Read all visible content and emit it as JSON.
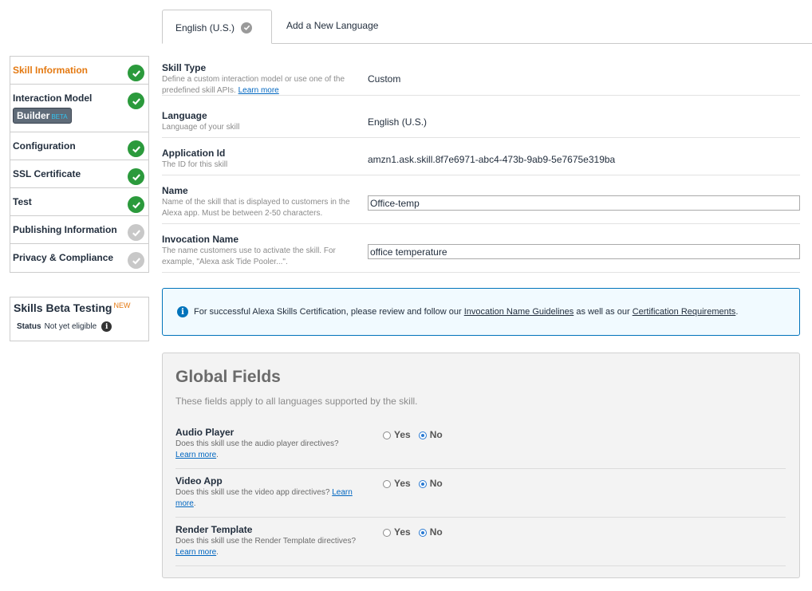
{
  "tabs": {
    "active": "English (U.S.)",
    "add": "Add a New Language"
  },
  "sidebar": {
    "items": [
      {
        "label": "Skill Information",
        "status": "done"
      },
      {
        "label": "Interaction Model",
        "status": "done",
        "badge": "Builder",
        "badge_tag": "BETA"
      },
      {
        "label": "Configuration",
        "status": "done"
      },
      {
        "label": "SSL Certificate",
        "status": "done"
      },
      {
        "label": "Test",
        "status": "done"
      },
      {
        "label": "Publishing Information",
        "status": "pending"
      },
      {
        "label": "Privacy & Compliance",
        "status": "pending"
      }
    ]
  },
  "beta_testing": {
    "title": "Skills Beta Testing",
    "tag": "NEW",
    "status_label": "Status",
    "status_value": "Not yet eligible"
  },
  "form": {
    "skill_type": {
      "label": "Skill Type",
      "desc": "Define a custom interaction model or use one of the predefined skill APIs.",
      "link": "Learn more",
      "value": "Custom"
    },
    "language": {
      "label": "Language",
      "desc": "Language of your skill",
      "value": "English (U.S.)"
    },
    "app_id": {
      "label": "Application Id",
      "desc": "The ID for this skill",
      "value": "amzn1.ask.skill.8f7e6971-abc4-473b-9ab9-5e7675e319ba"
    },
    "name": {
      "label": "Name",
      "desc": "Name of the skill that is displayed to customers in the Alexa app. Must be between 2-50 characters.",
      "value": "Office-temp"
    },
    "invocation": {
      "label": "Invocation Name",
      "desc": "The name customers use to activate the skill. For example, \"Alexa ask Tide Pooler...\".",
      "value": "office temperature"
    }
  },
  "notice": {
    "text1": "For successful Alexa Skills Certification, please review and follow our",
    "link1": "Invocation Name Guidelines",
    "text2": "as well as our",
    "link2": "Certification Requirements",
    "text3": "."
  },
  "global": {
    "title": "Global Fields",
    "subtitle": "These fields apply to all languages supported by the skill.",
    "yes": "Yes",
    "no": "No",
    "link": "Learn more",
    "rows": [
      {
        "label": "Audio Player",
        "desc": "Does this skill use the audio player directives?",
        "selected": "No"
      },
      {
        "label": "Video App",
        "desc": "Does this skill use the video app directives?",
        "selected": "No"
      },
      {
        "label": "Render Template",
        "desc": "Does this skill use the Render Template directives?",
        "selected": "No"
      }
    ]
  },
  "colors": {
    "accent_orange": "#e47911",
    "check_green": "#2b9a3c",
    "link_blue": "#0066c0",
    "info_blue": "#0073bb"
  }
}
